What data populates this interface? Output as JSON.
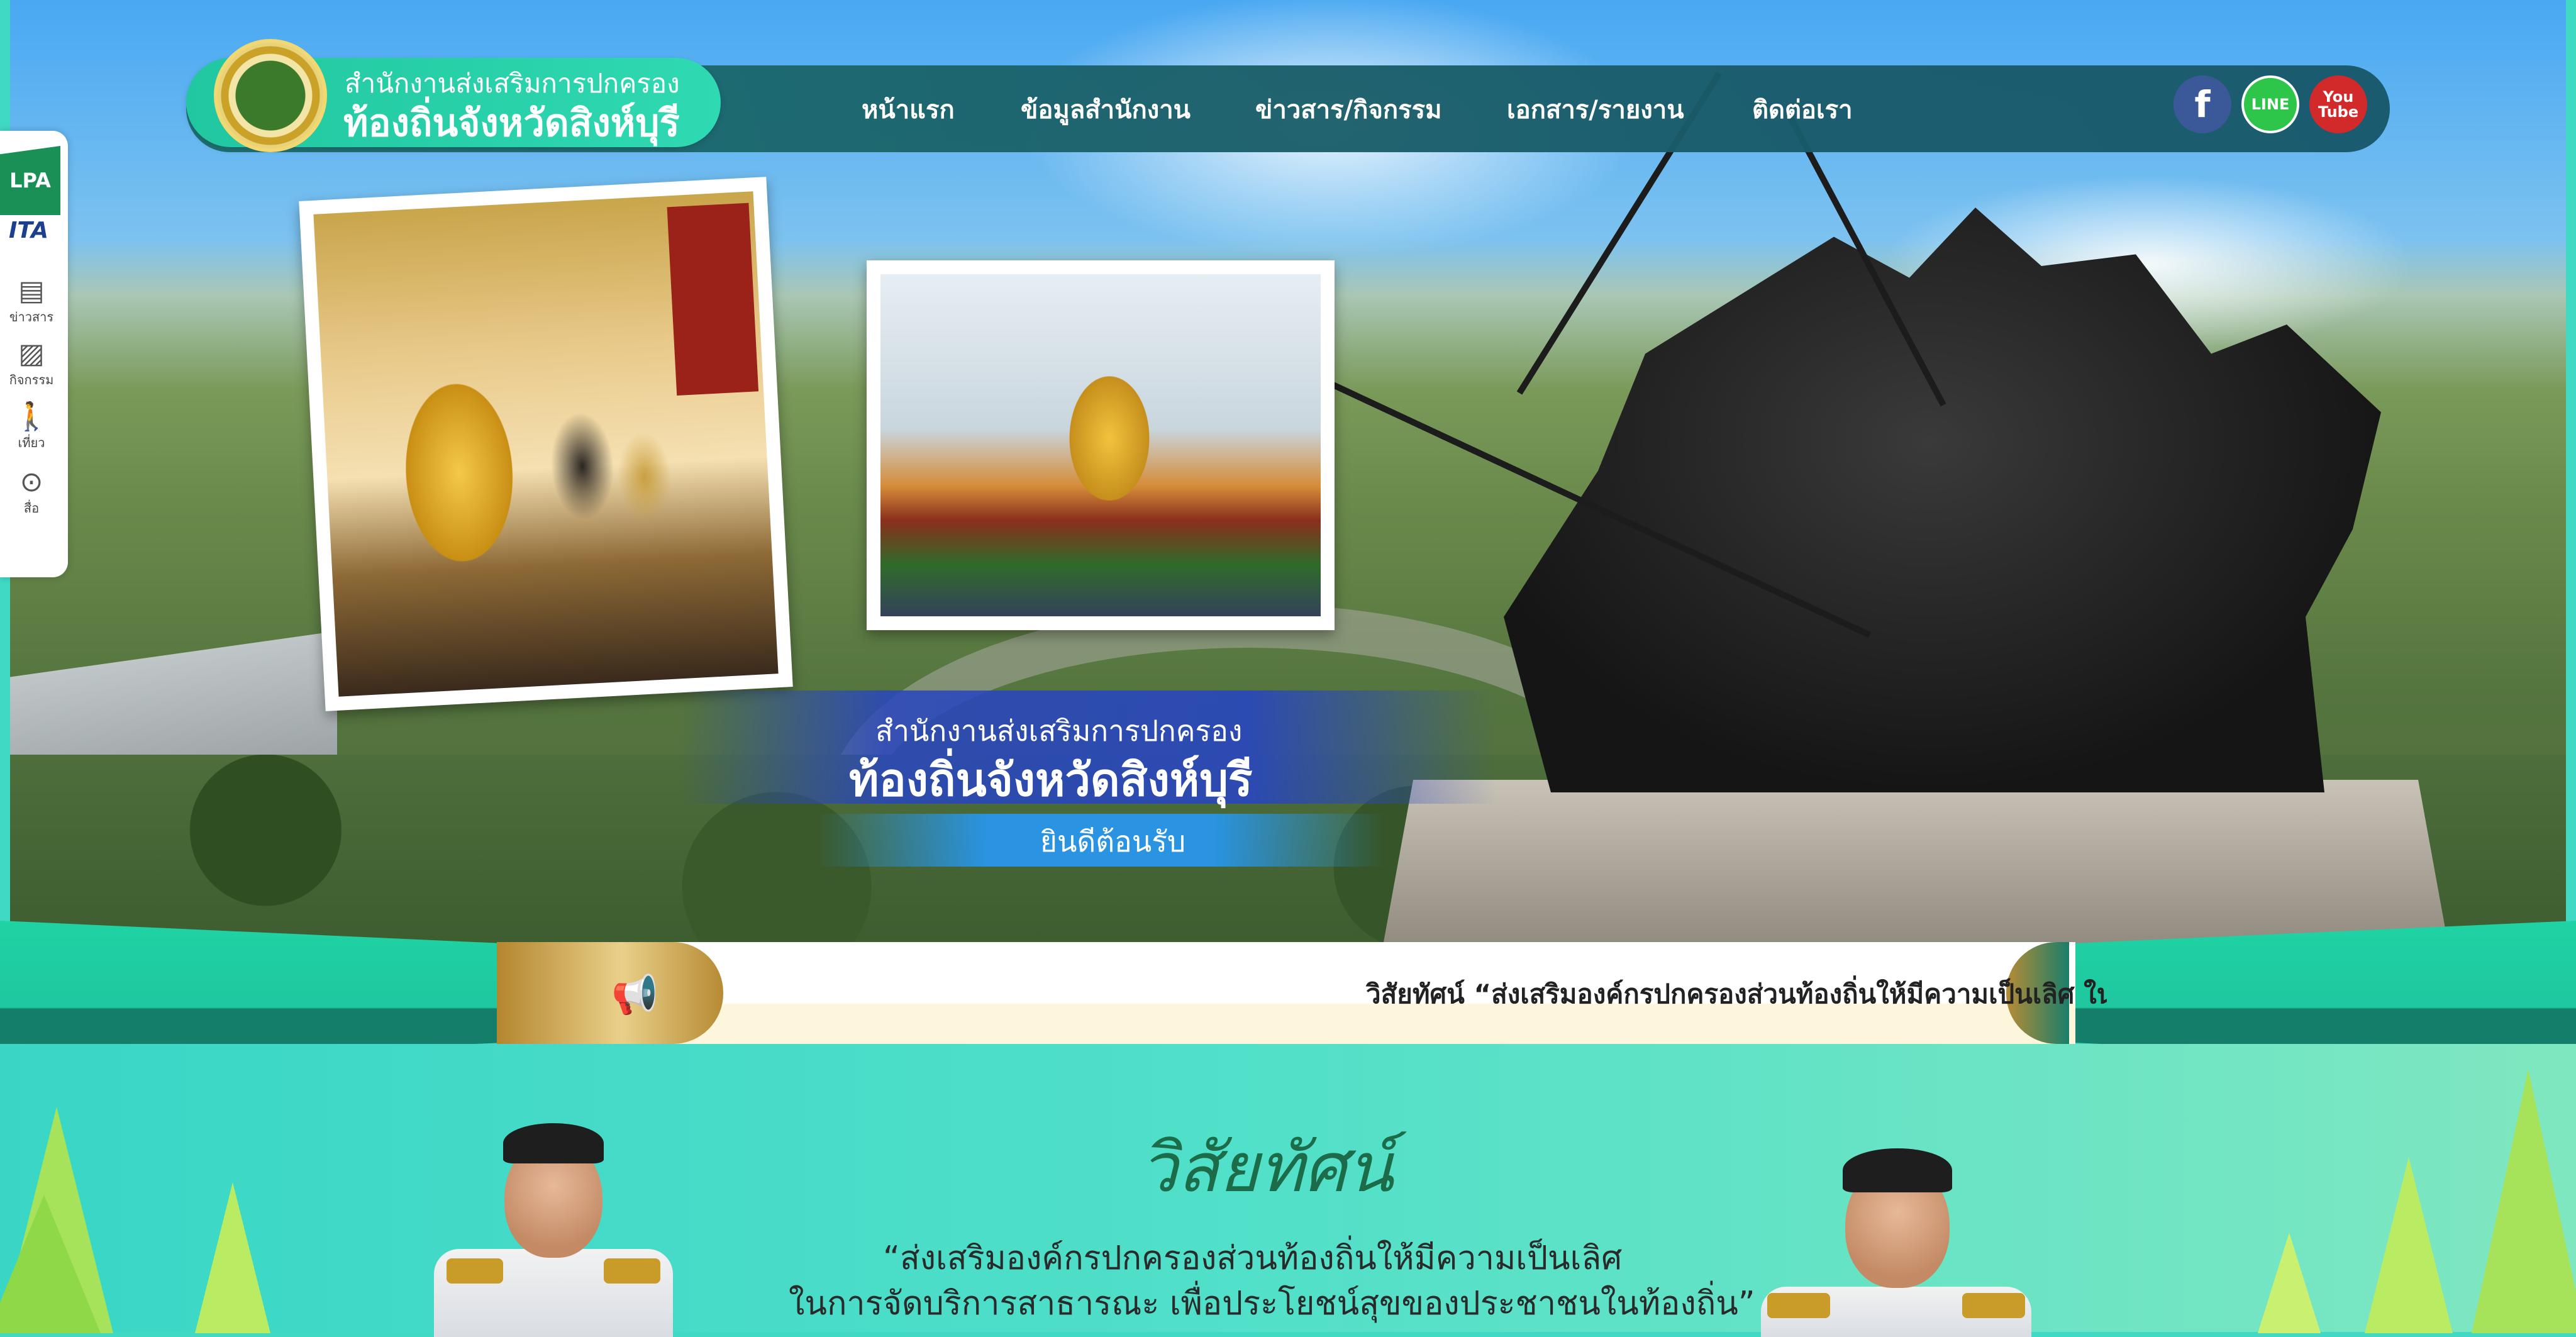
{
  "logo": {
    "line1": "สำนักงานส่งเสริมการปกครอง",
    "line2": "ท้องถิ่นจังหวัดสิงห์บุรี"
  },
  "nav": {
    "items": [
      "หน้าแรก",
      "ข้อมูลสำนักงาน",
      "ข่าวสาร/กิจกรรม",
      "เอกสาร/รายงาน",
      "ติดต่อเรา"
    ]
  },
  "social": {
    "facebook": "f",
    "line": "LINE",
    "youtube_top": "You",
    "youtube_bottom": "Tube"
  },
  "sidebar": {
    "lpa": "LPA",
    "ita": "ITA",
    "items": [
      {
        "label": "ข่าวสาร",
        "icon": "news-icon"
      },
      {
        "label": "กิจกรรม",
        "icon": "image-icon"
      },
      {
        "label": "เที่ยว",
        "icon": "walk-icon"
      },
      {
        "label": "สื่อ",
        "icon": "play-icon"
      }
    ]
  },
  "welcome": {
    "line1": "สำนักงานส่งเสริมการปกครอง",
    "line2": "ท้องถิ่นจังหวัดสิงห์บุรี",
    "line3": "ยินดีต้อนรับ"
  },
  "ticker": {
    "text": "วิสัยทัศน์ “ส่งเสริมองค์กรปกครองส่วนท้องถิ่นให้มีความเป็นเลิศ ในการจัดบริการสาธารณะ เพื่อประโยชน์สุขของประชาชนในท้องถิ่น”",
    "icon": "megaphone-icon"
  },
  "vision": {
    "title": "วิสัยทัศน์",
    "line1": "“ส่งเสริมองค์กรปกครองส่วนท้องถิ่นให้มีความเป็นเลิศ",
    "line2": "ในการจัดบริการสาธารณะ เพื่อประโยชน์สุขของประชาชนในท้องถิ่น”"
  },
  "colors": {
    "nav": "#1a5e69",
    "logo_pill": "#21c7a0",
    "ribbon": "#1fd3a4",
    "gold": "#c99b28"
  }
}
